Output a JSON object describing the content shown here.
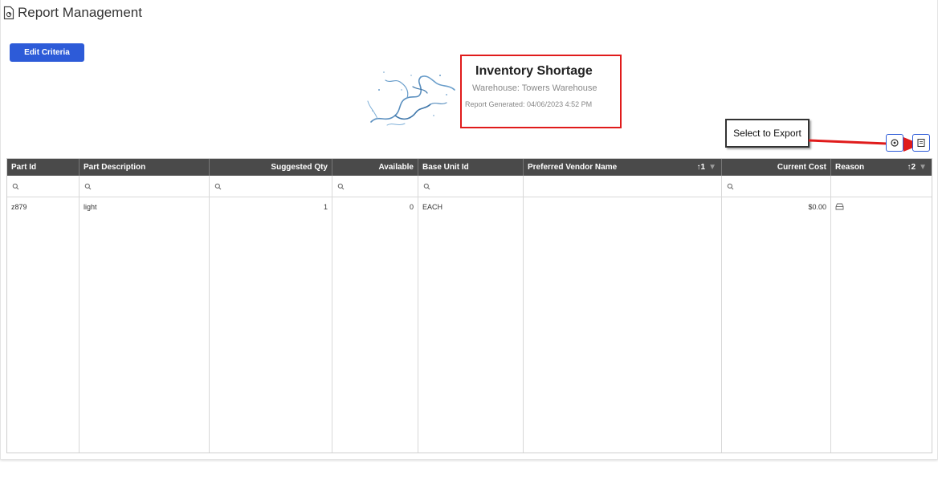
{
  "page": {
    "title": "Report Management"
  },
  "toolbar": {
    "edit_criteria_label": "Edit Criteria"
  },
  "report": {
    "title": "Inventory Shortage",
    "warehouse": "Warehouse: Towers Warehouse",
    "generated": "Report Generated: 04/06/2023 4:52 PM"
  },
  "annotation": {
    "callout": "Select to Export"
  },
  "grid": {
    "columns": [
      "Part Id",
      "Part Description",
      "Suggested Qty",
      "Available",
      "Base Unit Id",
      "Preferred Vendor Name",
      "Current Cost",
      "Reason"
    ],
    "sort": {
      "vendor": "↑1",
      "reason": "↑2"
    },
    "rows": [
      {
        "part_id": "z879",
        "description": "light",
        "suggested_qty": "1",
        "available": "0",
        "base_unit": "EACH",
        "vendor": "",
        "cost": "$0.00",
        "reason": ""
      }
    ]
  },
  "colors": {
    "accent": "#2d5bd8",
    "header_bg": "#4a4a4a",
    "highlight": "#e01b1b"
  }
}
